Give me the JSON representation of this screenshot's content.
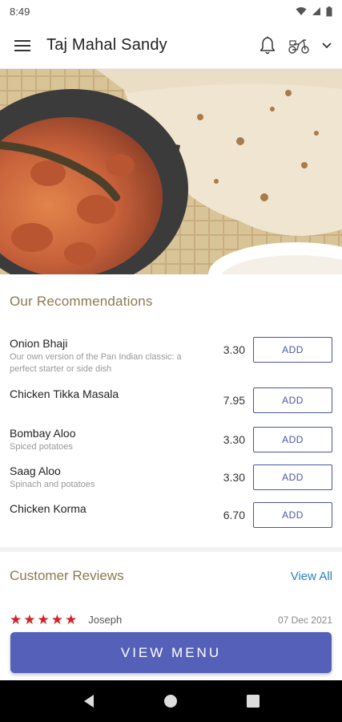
{
  "status_bar": {
    "time": "8:49",
    "icons": [
      "wifi-icon",
      "signal-icon",
      "battery-icon"
    ]
  },
  "app_bar": {
    "title": "Taj Mahal Sandy",
    "icons": [
      "menu-icon",
      "bell-icon",
      "scooter-icon",
      "chevron-down-icon"
    ]
  },
  "recommendations": {
    "title": "Our Recommendations",
    "add_label": "ADD",
    "items": [
      {
        "name": "Onion Bhaji",
        "description": "Our own version of the Pan Indian classic: a perfect starter or side dish",
        "price": "3.30"
      },
      {
        "name": "Chicken Tikka Masala",
        "description": "",
        "price": "7.95"
      },
      {
        "name": "Bombay Aloo",
        "description": "Spiced potatoes",
        "price": "3.30"
      },
      {
        "name": "Saag Aloo",
        "description": "Spinach and potatoes",
        "price": "3.30"
      },
      {
        "name": "Chicken Korma",
        "description": "",
        "price": "6.70"
      }
    ]
  },
  "reviews": {
    "title": "Customer Reviews",
    "view_all": "View All",
    "items": [
      {
        "stars": 5,
        "reviewer": "Joseph",
        "date": "07 Dec 2021"
      }
    ]
  },
  "cta": {
    "label": "VIEW MENU"
  },
  "colors": {
    "accent": "#5560b8",
    "add_border": "#4a56a8",
    "section_title": "#8a7a52",
    "link": "#2e7fb8",
    "star": "#d3222a"
  }
}
